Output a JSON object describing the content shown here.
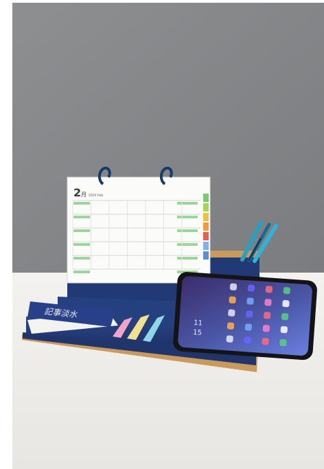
{
  "calendar": {
    "month_number": "2",
    "month_suffix": "月",
    "month_title_small": "2024 Feb",
    "tab_colors": [
      "#7ac96f",
      "#a8d35a",
      "#f0c040",
      "#f39a3a",
      "#e6604a",
      "#7fb3e6",
      "#5a8fd6"
    ]
  },
  "notebook": {
    "cover_text": "記事淡水"
  },
  "phone": {
    "clock_hour": "11",
    "clock_minute": "15"
  },
  "colors": {
    "wall": "#8e8f91",
    "table": "#f2f1ee",
    "navy": "#213a76",
    "cork": "#c99a5b",
    "sticky_pink": "#f2a3c8",
    "sticky_yellow": "#f2df8f",
    "sticky_cyan": "#8fd6e6"
  }
}
